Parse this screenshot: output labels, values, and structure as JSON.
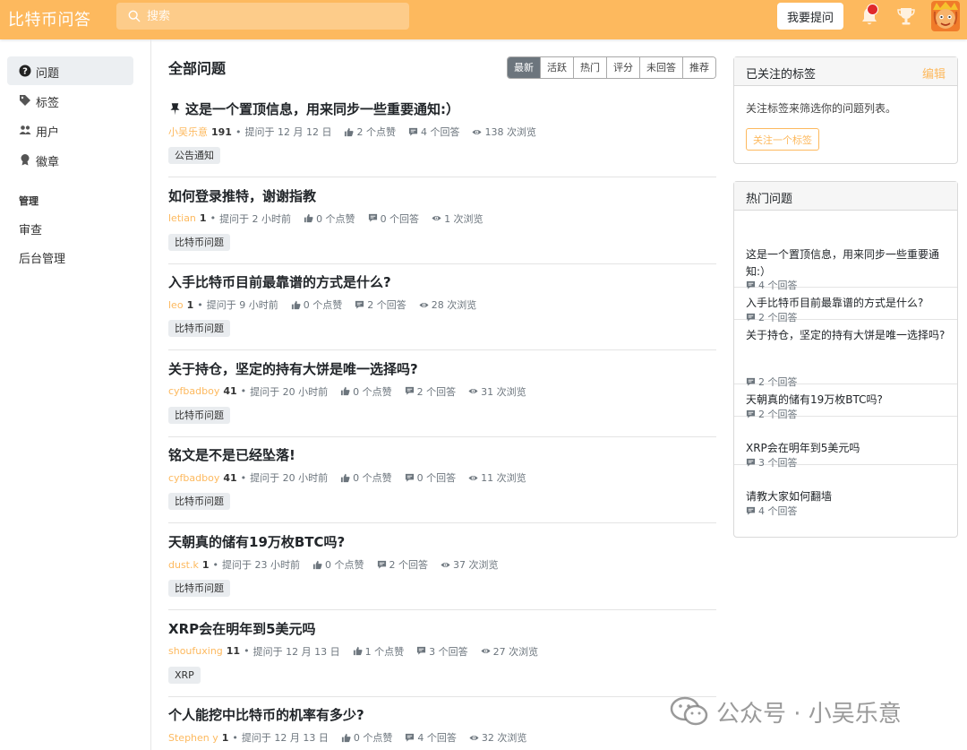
{
  "header": {
    "brand": "比特币问答",
    "search_placeholder": "搜索",
    "ask_button": "我要提问",
    "accent": "#fdb95e",
    "notification_color": "#e0292b"
  },
  "sidebar": {
    "items": [
      {
        "label": "问题",
        "icon": "question-circle-icon",
        "active": true
      },
      {
        "label": "标签",
        "icon": "tag-icon"
      },
      {
        "label": "用户",
        "icon": "users-icon"
      },
      {
        "label": "徽章",
        "icon": "badge-icon"
      }
    ],
    "admin_heading": "管理",
    "admin_items": [
      "审查",
      "后台管理"
    ]
  },
  "main": {
    "title": "全部问题",
    "tabs": [
      {
        "label": "最新",
        "active": true
      },
      {
        "label": "活跃"
      },
      {
        "label": "热门"
      },
      {
        "label": "评分"
      },
      {
        "label": "未回答"
      },
      {
        "label": "推荐"
      }
    ],
    "questions": [
      {
        "title": "这是一个置顶信息，用来同步一些重要通知:）",
        "pinned": true,
        "author": "小吴乐意",
        "rep": "191",
        "asked": "提问于 12 月 12 日",
        "votes": "2 个点赞",
        "answers": "4 个回答",
        "views": "138 次浏览",
        "tag": "公告通知"
      },
      {
        "title": "如何登录推特，谢谢指教",
        "author": "letian",
        "rep": "1",
        "asked": "提问于 2 小时前",
        "votes": "0 个点赞",
        "answers": "0 个回答",
        "views": "1 次浏览",
        "tag": "比特币问题"
      },
      {
        "title": "入手比特币目前最靠谱的方式是什么?",
        "author": "leo",
        "rep": "1",
        "asked": "提问于 9 小时前",
        "votes": "0 个点赞",
        "answers": "2 个回答",
        "views": "28 次浏览",
        "tag": "比特币问题"
      },
      {
        "title": "关于持仓，坚定的持有大饼是唯一选择吗?",
        "author": "cyfbadboy",
        "rep": "41",
        "asked": "提问于 20 小时前",
        "votes": "0 个点赞",
        "answers": "2 个回答",
        "views": "31 次浏览",
        "tag": "比特币问题"
      },
      {
        "title": "铭文是不是已经坠落!",
        "author": "cyfbadboy",
        "rep": "41",
        "asked": "提问于 20 小时前",
        "votes": "0 个点赞",
        "answers": "0 个回答",
        "views": "11 次浏览",
        "tag": "比特币问题"
      },
      {
        "title": "天朝真的储有19万枚BTC吗?",
        "author": "dust.k",
        "rep": "1",
        "asked": "提问于 23 小时前",
        "votes": "0 个点赞",
        "answers": "2 个回答",
        "views": "37 次浏览",
        "tag": "比特币问题"
      },
      {
        "title": "XRP会在明年到5美元吗",
        "author": "shoufuxing",
        "rep": "11",
        "asked": "提问于 12 月 13 日",
        "votes": "1 个点赞",
        "answers": "3 个回答",
        "views": "27 次浏览",
        "tag": "XRP"
      },
      {
        "title": "个人能挖中比特币的机率有多少?",
        "author": "Stephen y",
        "rep": "1",
        "asked": "提问于 12 月 13 日",
        "votes": "0 个点赞",
        "answers": "4 个回答",
        "views": "32 次浏览",
        "tag": ""
      }
    ]
  },
  "followed_tags": {
    "title": "已关注的标签",
    "edit": "编辑",
    "text": "关注标签来筛选你的问题列表。",
    "button": "关注一个标签"
  },
  "hot_questions": {
    "title": "热门问题",
    "items": [
      {
        "title": "这是一个置顶信息，用来同步一些重要通知:）",
        "answers": "4 个回答"
      },
      {
        "title": "入手比特币目前最靠谱的方式是什么?",
        "answers": "2 个回答"
      },
      {
        "title": "关于持仓，坚定的持有大饼是唯一选择吗?",
        "answers": "2 个回答"
      },
      {
        "title": "天朝真的储有19万枚BTC吗?",
        "answers": "2 个回答"
      },
      {
        "title": "XRP会在明年到5美元吗",
        "answers": "3 个回答"
      },
      {
        "title": "请教大家如何翻墙",
        "answers": "4 个回答"
      }
    ]
  },
  "watermark": "公众号 · 小吴乐意"
}
